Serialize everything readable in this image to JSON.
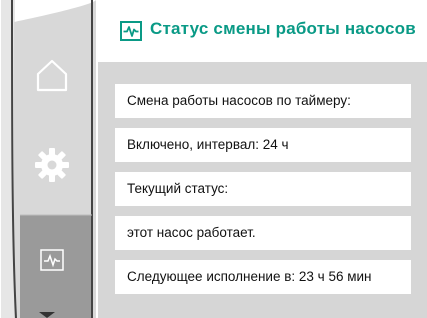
{
  "header": {
    "title": "Статус смены работы насосов",
    "title_icon": "pulse-monitor-icon",
    "accent_color": "#0a9a86"
  },
  "sidebar": {
    "items": [
      {
        "icon": "home-icon",
        "selected": false
      },
      {
        "icon": "gear-icon",
        "selected": false
      },
      {
        "icon": "pulse-monitor-icon",
        "selected": true
      }
    ],
    "scroll_indicator": "down-arrow-icon"
  },
  "rows": [
    {
      "text": "Смена работы насосов по таймеру:"
    },
    {
      "text": "Включено, интервал: 24 ч"
    },
    {
      "text": "Текущий статус:"
    },
    {
      "text": "этот насос работает."
    },
    {
      "text": "Следующее исполнение в: 23 ч 56 мин"
    }
  ]
}
